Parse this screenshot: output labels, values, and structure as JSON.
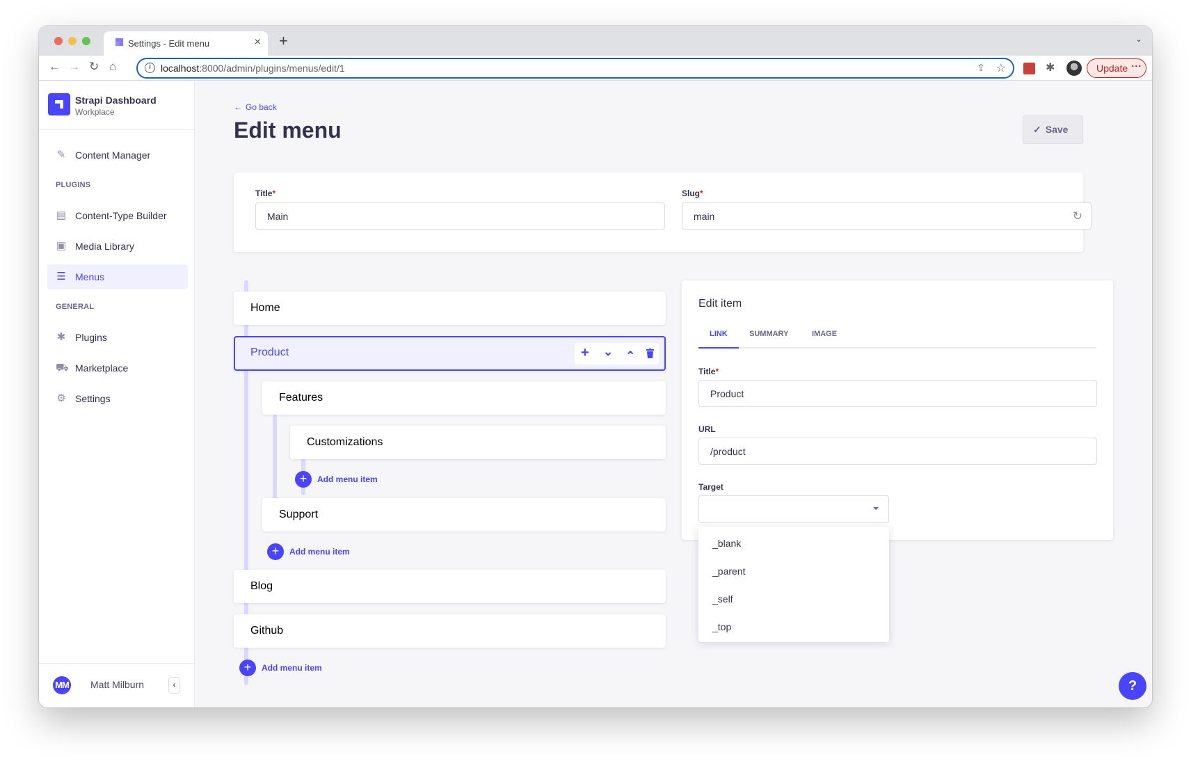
{
  "browser": {
    "tab_title": "Settings - Edit menu",
    "url_host": "localhost",
    "url_rest": ":8000/admin/plugins/menus/edit/1",
    "update_label": "Update"
  },
  "sidebar": {
    "brand_name": "Strapi Dashboard",
    "brand_sub": "Workplace",
    "content_manager": "Content Manager",
    "section_plugins": "PLUGINS",
    "plugins_items": [
      {
        "label": "Content-Type Builder",
        "icon": "layout-icon"
      },
      {
        "label": "Media Library",
        "icon": "image-icon"
      },
      {
        "label": "Menus",
        "icon": "menu-icon",
        "active": true
      }
    ],
    "section_general": "GENERAL",
    "general_items": [
      {
        "label": "Plugins",
        "icon": "puzzle-icon"
      },
      {
        "label": "Marketplace",
        "icon": "cart-icon"
      },
      {
        "label": "Settings",
        "icon": "gear-icon"
      }
    ],
    "user_initials": "MM",
    "user_name": "Matt Milburn"
  },
  "header": {
    "go_back": "Go back",
    "title": "Edit menu",
    "save_label": "Save"
  },
  "menu_form": {
    "title_label": "Title",
    "title_value": "Main",
    "slug_label": "Slug",
    "slug_value": "main",
    "required_mark": "*"
  },
  "tree": {
    "items": [
      {
        "label": "Home",
        "level": 0
      },
      {
        "label": "Product",
        "level": 0,
        "selected": true
      },
      {
        "label": "Features",
        "level": 1
      },
      {
        "label": "Customizations",
        "level": 2
      },
      {
        "label": "Support",
        "level": 1
      },
      {
        "label": "Blog",
        "level": 0
      },
      {
        "label": "Github",
        "level": 0
      }
    ],
    "add_label": "Add menu item"
  },
  "edit_item": {
    "title": "Edit item",
    "tabs": [
      "LINK",
      "SUMMARY",
      "IMAGE"
    ],
    "active_tab": "LINK",
    "title_label": "Title",
    "title_value": "Product",
    "url_label": "URL",
    "url_value": "/product",
    "target_label": "Target",
    "target_value": "",
    "target_options": [
      "_blank",
      "_parent",
      "_self",
      "_top"
    ]
  },
  "help_label": "?"
}
